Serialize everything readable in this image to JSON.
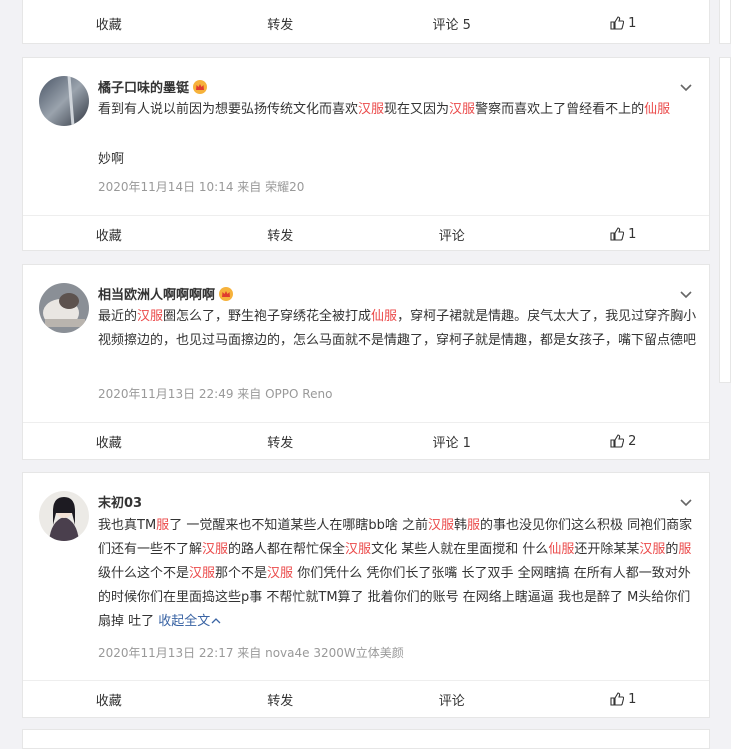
{
  "actions": {
    "fav": "收藏",
    "share": "转发",
    "comment": "评论"
  },
  "card0": {
    "comment_label": "评论 5",
    "likes": "1"
  },
  "card1": {
    "user": "橘子口味的墨铤",
    "segments": [
      "看到有人说以前因为想要弘扬传统文化而喜欢",
      "汉服",
      "现在又因为",
      "汉服",
      "警察而喜欢上了曾经看不上的",
      "仙服"
    ],
    "line2": "妙啊",
    "meta": "2020年11月14日 10:14  来自 荣耀20",
    "likes": "1"
  },
  "card2": {
    "user": "相当欧洲人啊啊啊啊",
    "segments": [
      "最近的",
      "汉服",
      "圈怎么了，野生袍子穿绣花全被打成",
      "仙服",
      "，穿柯子裙就是情趣。戾气太大了，我见过穿齐胸小视频擦边的，也见过马面擦边的，怎么马面就不是情趣了，穿柯子就是情趣，都是女孩子，嘴下留点德吧"
    ],
    "meta": "2020年11月13日 22:49  来自 OPPO Reno",
    "comment_label": "评论 1",
    "likes": "2"
  },
  "card3": {
    "user": "末初03",
    "segments": [
      "我也真TM",
      "服",
      "了 一觉醒来也不知道某些人在哪瞎bb啥 之前",
      "汉服",
      "韩",
      "服",
      "的事也没见你们这么积极 同袍们商家们还有一些不了解",
      "汉服",
      "的路人都在帮忙保全",
      "汉服",
      "文化 某些人就在里面搅和 什么",
      "仙服",
      "还开除某某",
      "汉服",
      "的",
      "服",
      "级什么这个不是",
      "汉服",
      "那个不是",
      "汉服",
      " 你们凭什么 凭你们长了张嘴 长了双手 全网瞎搞 在所有人都一致对外的时候你们在里面捣这些p事 不帮忙就TM算了 批着你们的账号 在网络上瞎逼逼 我也是醉了 M头给你们扇掉 吐了 "
    ],
    "more": "收起全文",
    "meta": "2020年11月13日 22:17  来自 nova4e 3200W立体美颜",
    "likes": "1"
  },
  "colors": {
    "highlight": "#eb4a4a",
    "link": "#3a64a4",
    "meta": "#999999"
  }
}
